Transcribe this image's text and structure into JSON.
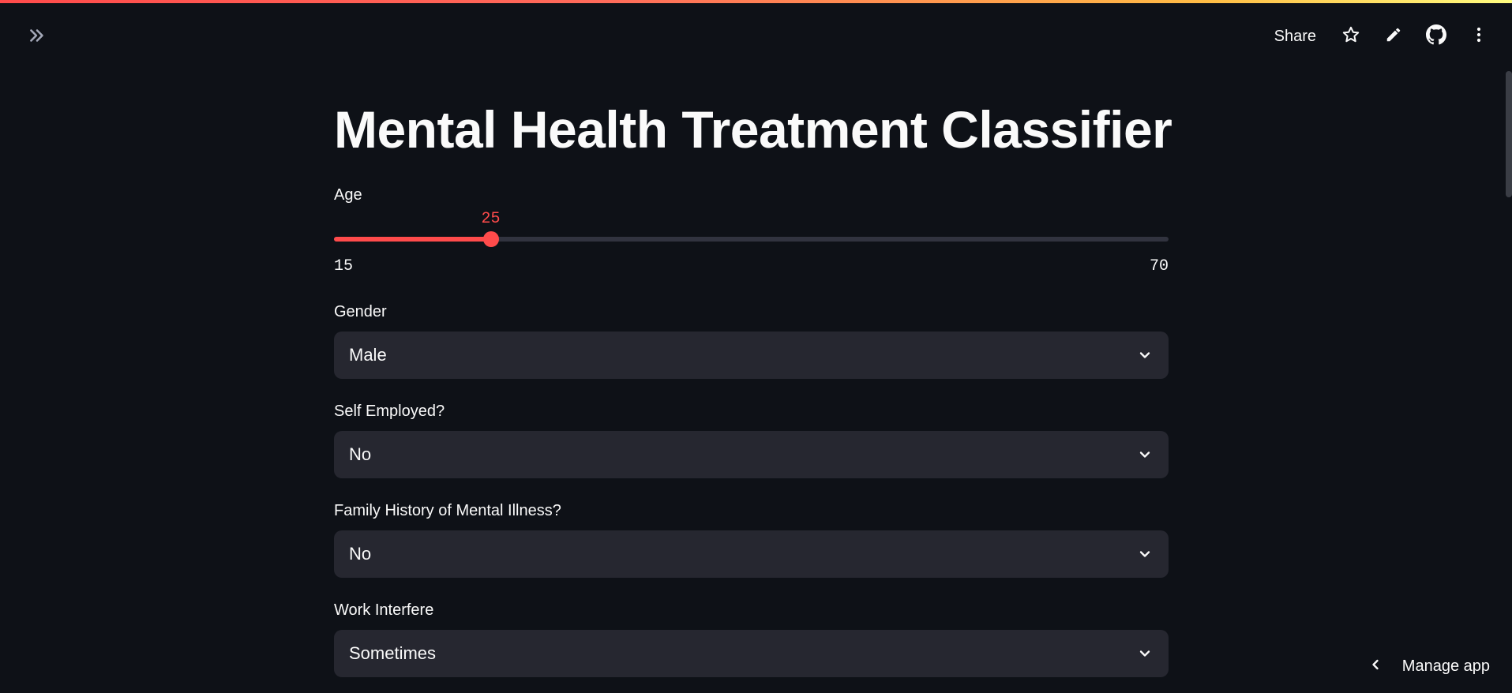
{
  "colors": {
    "background": "#0e1117",
    "accent": "#ff4b4b",
    "select_bg": "#262730",
    "track": "#31333f"
  },
  "header": {
    "sidebar_toggle_icon": "double-chevron-right-icon",
    "share_label": "Share",
    "icons": [
      "star-icon",
      "pencil-icon",
      "github-icon",
      "more-vertical-icon"
    ]
  },
  "main": {
    "title": "Mental Health Treatment Classifier",
    "age": {
      "label": "Age",
      "value": 25,
      "value_text": "25",
      "min": 15,
      "max": 70,
      "min_text": "15",
      "max_text": "70"
    },
    "gender": {
      "label": "Gender",
      "value": "Male"
    },
    "self_employed": {
      "label": "Self Employed?",
      "value": "No"
    },
    "family_history": {
      "label": "Family History of Mental Illness?",
      "value": "No"
    },
    "work_interfere": {
      "label": "Work Interfere",
      "value": "Sometimes"
    }
  },
  "footer": {
    "manage_label": "Manage app",
    "manage_icon": "chevron-left-icon"
  }
}
